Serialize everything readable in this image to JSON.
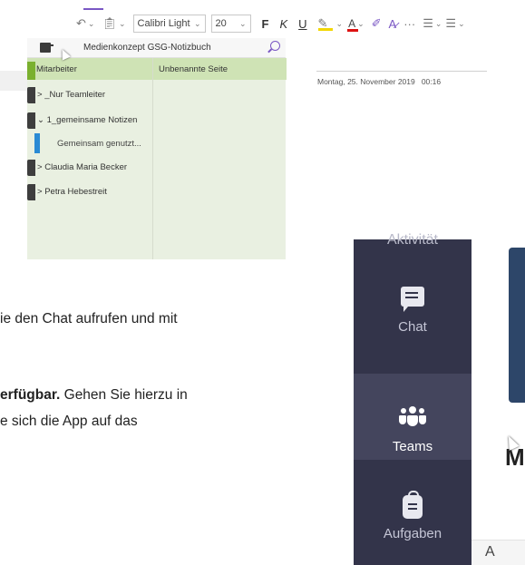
{
  "onenote": {
    "toolbar": {
      "undo_icon": "undo-icon",
      "clipboard_icon": "clipboard-icon",
      "font_name": "Calibri Light",
      "font_size": "20",
      "bold_label": "F",
      "italic_label": "K",
      "underline_label": "U",
      "more_label": "···"
    },
    "notebook_name": "Medienkonzept GSG-Notizbuch",
    "sections": [
      {
        "label": "Mitarbeiter",
        "active": true
      },
      {
        "label": "_Nur Teamleiter",
        "prefix": ">"
      },
      {
        "label": "1_gemeinsame Notizen",
        "prefix": "⌄"
      },
      {
        "label": "Gemeinsam genutzt..."
      },
      {
        "label": "Claudia Maria Becker",
        "prefix": ">"
      },
      {
        "label": "Petra Hebestreit",
        "prefix": ">"
      }
    ],
    "pages": [
      {
        "label": "Unbenannte Seite",
        "active": true
      }
    ],
    "page_date": "Montag, 25. November 2019",
    "page_time": "00:16"
  },
  "document": {
    "line1": "ie den Chat aufrufen und mit",
    "line2_bold": "erfügbar.",
    "line2_rest": " Gehen Sie hierzu in",
    "line3": "e sich die App auf das"
  },
  "teams_rail": {
    "top_partial": "Aktivität",
    "items": [
      {
        "label": "Chat",
        "icon": "chat-icon",
        "selected": false
      },
      {
        "label": "Teams",
        "icon": "teams-icon",
        "selected": true
      },
      {
        "label": "Aufgaben",
        "icon": "tasks-bag-icon",
        "selected": false
      }
    ]
  },
  "right_content": {
    "partial_letter": "M",
    "bottom_partial": "A"
  },
  "colors": {
    "rail_bg": "#33344a",
    "rail_selected": "#44455d",
    "onenote_accent": "#7a57c4",
    "section_active": "#cfe3b5",
    "panel_bg": "#e9f0e1"
  }
}
